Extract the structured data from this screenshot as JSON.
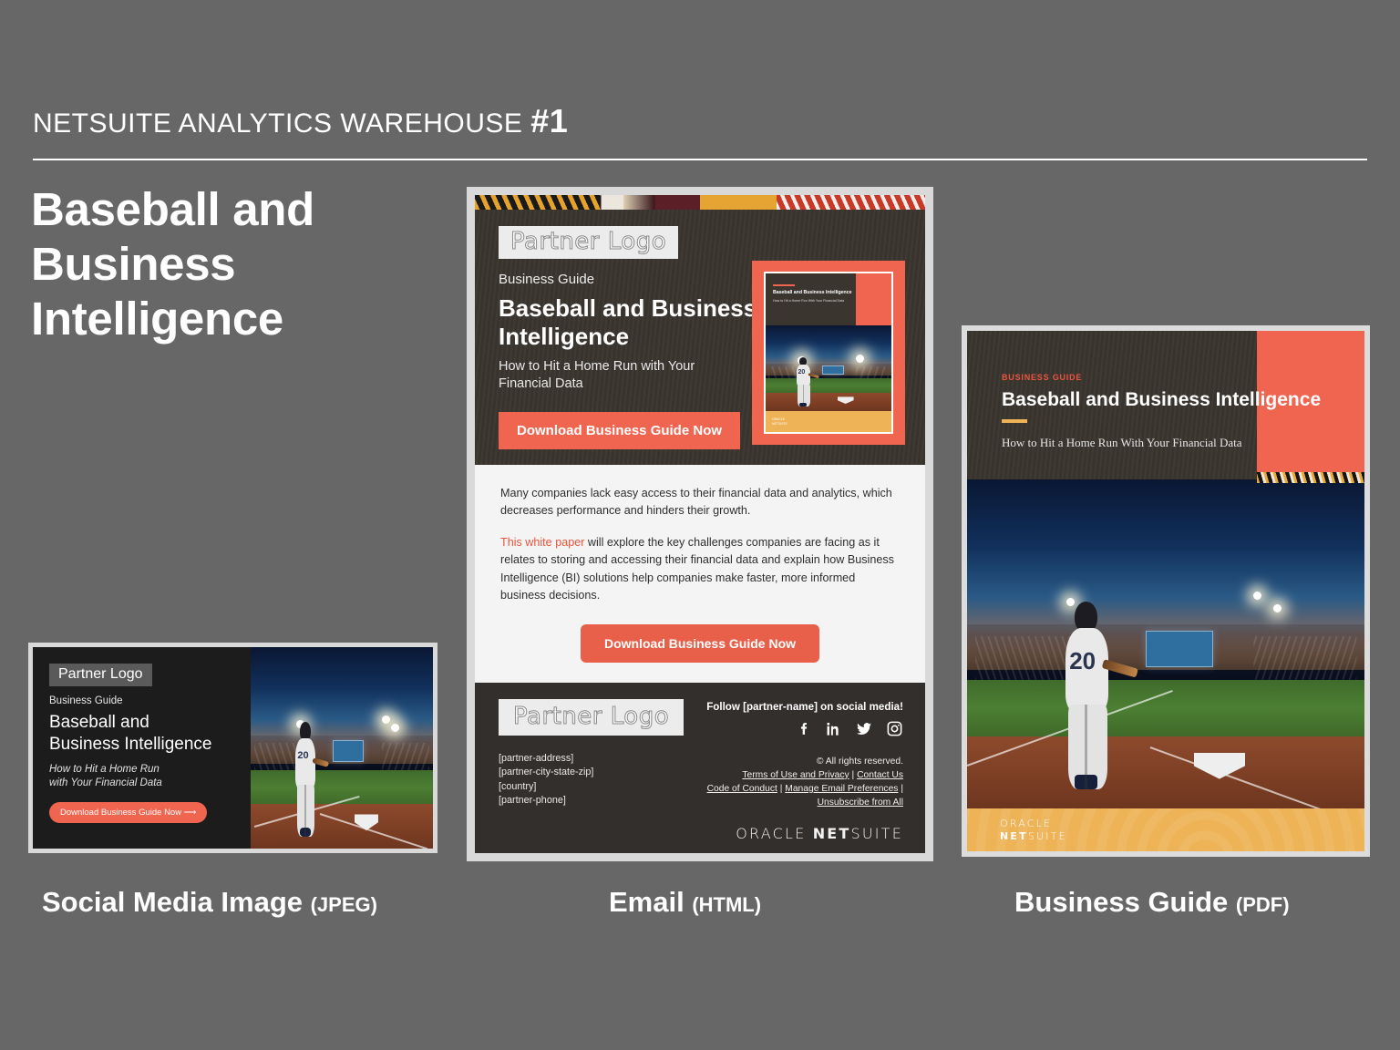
{
  "header": {
    "eyebrow": "NETSUITE ANALYTICS WAREHOUSE ",
    "number": "#1",
    "title": "Baseball and Business Intelligence"
  },
  "social_media_image": {
    "logo_badge": "Partner Logo",
    "kicker": "Business Guide",
    "title_line1": "Baseball and",
    "title_line2": "Business Intelligence",
    "sub_line1": "How to Hit a Home Run",
    "sub_line2": "with Your Financial Data",
    "cta": "Download Business Guide Now ⟶",
    "photo_jersey_number": "20",
    "caption_main": "Social Media Image ",
    "caption_format": "(JPEG)"
  },
  "email": {
    "hero": {
      "logo_badge": "Partner Logo",
      "kicker": "Business Guide",
      "title_line1": "Baseball and Business",
      "title_line2": "Intelligence",
      "sub_line1": "How to Hit a Home Run with Your",
      "sub_line2": "Financial Data",
      "cta": "Download Business Guide Now",
      "cover": {
        "title": "Baseball and Business Intelligence",
        "sub": "How to Hit a Home Run With Your Financial Data",
        "jersey_number": "20",
        "footer_brand_line1": "ORACLE",
        "footer_brand_line2": "NETSUITE"
      }
    },
    "body": {
      "paragraph1": "Many companies lack easy access to their financial data and analytics, which decreases performance and hinders their growth.",
      "paragraph2_highlight": "This white paper",
      "paragraph2_rest": " will explore the key challenges companies are facing as it relates to storing and accessing their financial data and explain how Business Intelligence (BI) solutions help companies make faster, more informed business decisions.",
      "cta": "Download Business Guide Now"
    },
    "footer": {
      "logo_badge": "Partner Logo",
      "address_line1": "[partner-address]",
      "address_line2": "[partner-city-state-zip]",
      "address_line3": "[country]",
      "address_line4": "[partner-phone]",
      "follow_text": "Follow [partner-name] on social media!",
      "social_icons": [
        "facebook-icon",
        "linkedin-icon",
        "twitter-icon",
        "instagram-icon"
      ],
      "rights": "© All rights reserved.",
      "link_terms": "Terms of Use and Privacy",
      "link_contact": "Contact Us",
      "link_conduct": "Code of Conduct",
      "link_preferences": "Manage Email Preferences",
      "link_unsubscribe": "Unsubscribe from All",
      "sep": " | ",
      "brand_oracle": "ORACLE",
      "brand_netsuite_bold": "NET",
      "brand_netsuite_light": "SUITE"
    },
    "caption_main": "Email ",
    "caption_format": "(HTML)"
  },
  "business_guide": {
    "kicker": "BUSINESS GUIDE",
    "title": "Baseball and Business Intelligence",
    "sub": "How to Hit a Home Run With Your Financial Data",
    "jersey_number": "20",
    "footer_brand_line1": "ORACLE",
    "footer_brand_line2_bold": "NET",
    "footer_brand_line2_light": "SUITE",
    "caption_main": "Business Guide ",
    "caption_format": "(PDF)"
  },
  "colors": {
    "canvas_background": "#676767",
    "accent_coral": "#ef6550",
    "accent_amber": "#eeb356",
    "dark_brown": "#3b352f",
    "footer_dark": "#332f2c",
    "body_light": "#f4f4f4",
    "highlight_red": "#e8553e"
  }
}
